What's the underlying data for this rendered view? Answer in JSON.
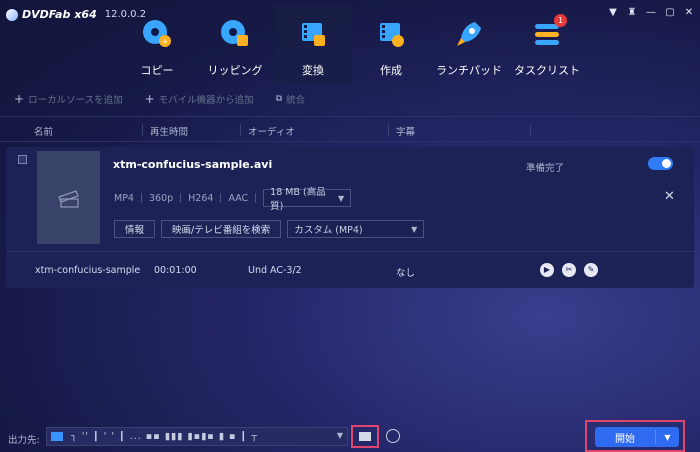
{
  "app": {
    "name": "DVDFab",
    "arch": "x64",
    "version": "12.0.0.2"
  },
  "window_controls": [
    "▼",
    "♜",
    "—",
    "▢",
    "✕"
  ],
  "nav": {
    "tabs": [
      {
        "label": "コピー",
        "icon": "disc-copy-icon"
      },
      {
        "label": "リッピング",
        "icon": "disc-rip-icon"
      },
      {
        "label": "変換",
        "icon": "video-convert-icon"
      },
      {
        "label": "作成",
        "icon": "video-create-icon"
      },
      {
        "label": "ランチパッド",
        "icon": "rocket-icon"
      },
      {
        "label": "タスクリスト",
        "icon": "task-list-icon",
        "badge": "1"
      }
    ],
    "active": "変換"
  },
  "toolbar": {
    "add_local": "ローカルソースを追加",
    "add_mobile": "モバイル機器から追加",
    "merge": "統合"
  },
  "columns": {
    "name": "名前",
    "duration": "再生時間",
    "audio": "オーディオ",
    "subtitle": "字幕"
  },
  "item": {
    "filename": "xtm-confucius-sample.avi",
    "status": "準備完了",
    "format": "MP4",
    "resolution": "360p",
    "codec": "H264",
    "audio_codec": "AAC",
    "size": "18 MB (高品質)",
    "info_button": "情報",
    "search_button": "映画/テレビ番組を検索",
    "profile": "カスタム (MP4)",
    "track": {
      "title": "xtm-confucius-sample",
      "duration": "00:01:00",
      "audio": "Und AC-3/2",
      "subtitle": "なし"
    }
  },
  "footer": {
    "output_label": "出力先:",
    "output_path": "┐ '' ┃ ' ' ┃ ... ▪▪ ▮▮▮ ▮▪▮▪ ▮ ▪ ┃ ┬",
    "start_button": "開始"
  },
  "colors": {
    "accent": "#2f6bf0",
    "highlight": "#e0456e",
    "toggle": "#2f7cf6"
  }
}
